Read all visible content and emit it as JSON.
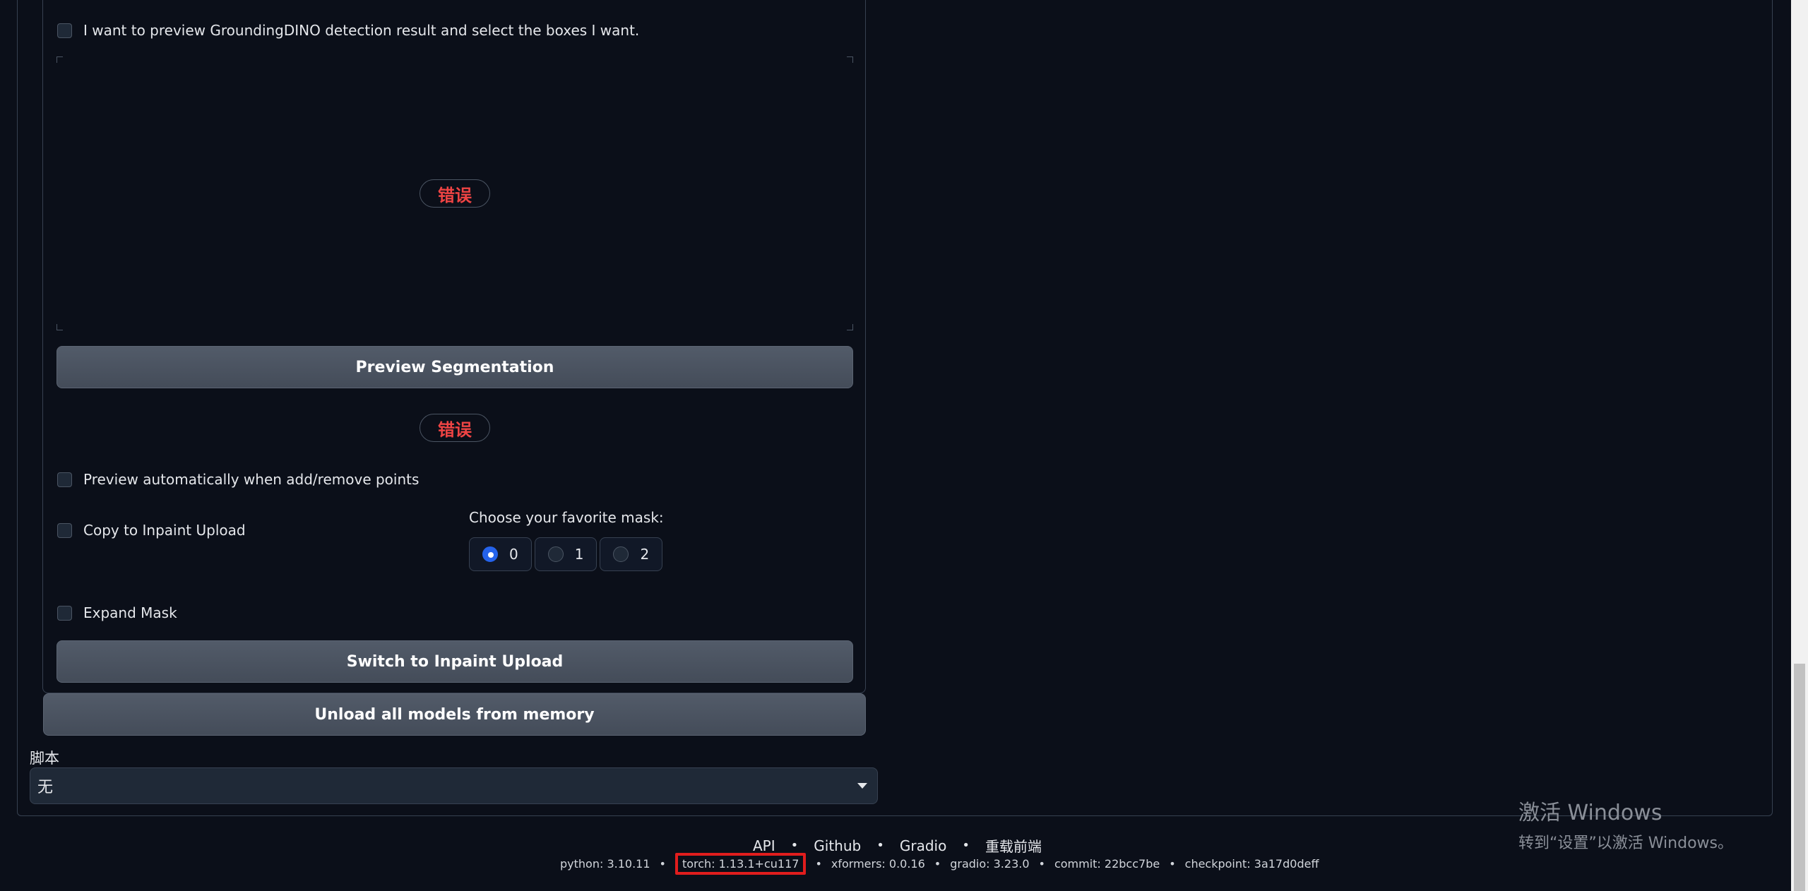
{
  "grounding_checkbox_label": "I want to preview GroundingDINO detection result and select the boxes I want.",
  "error_label": "错误",
  "preview_segmentation_button": "Preview Segmentation",
  "preview_auto_label": "Preview automatically when add/remove points",
  "copy_inpaint_label": "Copy to Inpaint Upload",
  "mask_choice": {
    "title": "Choose your favorite mask:",
    "options": [
      "0",
      "1",
      "2"
    ],
    "selected": "0"
  },
  "expand_mask_label": "Expand Mask",
  "switch_inpaint_button": "Switch to Inpaint Upload",
  "unload_models_button": "Unload all models from memory",
  "script": {
    "label": "脚本",
    "value": "无"
  },
  "footer": {
    "links": [
      "API",
      "Github",
      "Gradio",
      "重载前端"
    ],
    "python": "python: 3.10.11",
    "torch": "torch: 1.13.1+cu117",
    "xformers": "xformers: 0.0.16",
    "gradio": "gradio: 3.23.0",
    "commit": "commit: 22bcc7be",
    "checkpoint": "checkpoint: 3a17d0deff"
  },
  "watermark": {
    "title": "激活 Windows",
    "subtitle": "转到“设置”以激活 Windows。"
  },
  "colors": {
    "background": "#0b0f19",
    "error": "#ef4444",
    "radio_selected": "#2563eb",
    "highlight_box": "#e11d1d"
  }
}
